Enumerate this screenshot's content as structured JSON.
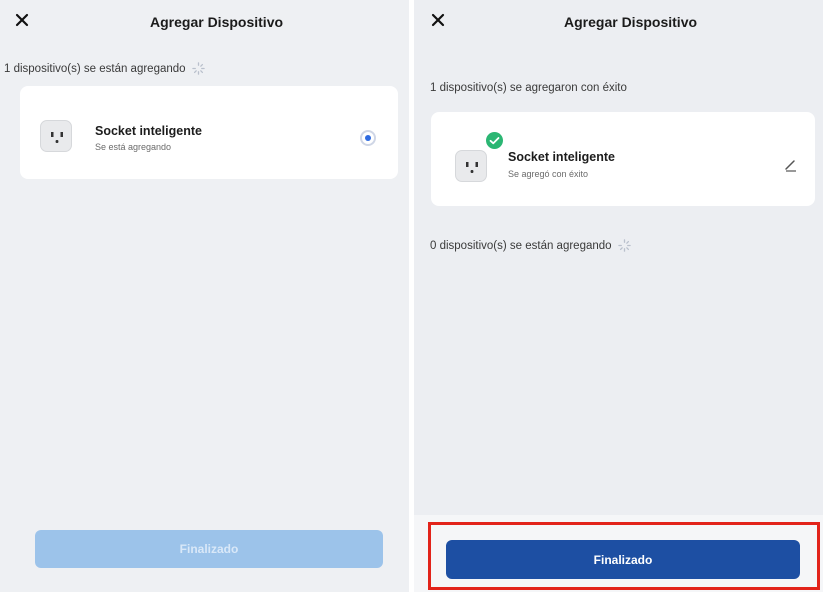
{
  "left": {
    "header": {
      "title": "Agregar Dispositivo",
      "close_icon": "close-icon"
    },
    "status_text": "1 dispositivo(s) se están agregando",
    "device": {
      "name": "Socket inteligente",
      "status": "Se está agregando",
      "icon": "smart-plug-icon"
    },
    "finish_button_label": "Finalizado"
  },
  "right": {
    "header": {
      "title": "Agregar Dispositivo",
      "close_icon": "close-icon"
    },
    "success_text": "1 dispositivo(s) se agregaron con éxito",
    "device": {
      "name": "Socket inteligente",
      "status": "Se agregó con éxito",
      "icon": "smart-plug-icon"
    },
    "pending_text": "0 dispositivo(s) se están agregando",
    "finish_button_label": "Finalizado"
  },
  "colors": {
    "primary_button": "#1d4fa3",
    "disabled_button": "#9cc3ea",
    "success_badge": "#2bb673",
    "highlight": "#e2231a",
    "background": "#eef0f3"
  }
}
